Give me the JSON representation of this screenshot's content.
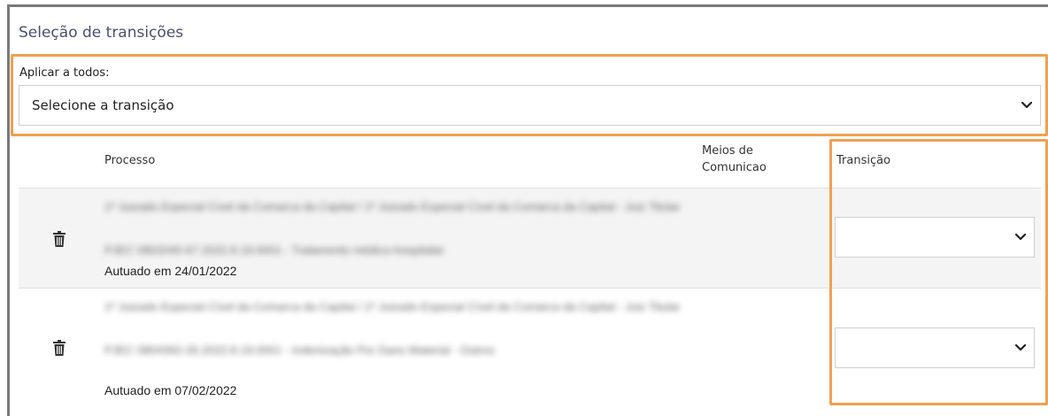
{
  "panel": {
    "title": "Seleção de transições"
  },
  "apply_all": {
    "label": "Aplicar a todos:",
    "select_value": "Selecione a transição"
  },
  "table": {
    "headers": {
      "processo": "Processo",
      "meios": "Meios de Comunicao",
      "transicao": "Transição"
    },
    "rows": [
      {
        "court": "1º Juizado Especial Cível da Comarca da Capital / 1º Juizado Especial Cível da Comarca da Capital - Juiz Titular",
        "process": "PJEC 0802045-67.2022.8.19.0001 - Tratamento médico-hospitalar",
        "autuado": "Autuado em 24/01/2022",
        "transition": ""
      },
      {
        "court": "1º Juizado Especial Cível da Comarca da Capital / 1º Juizado Especial Cível da Comarca da Capital - Juiz Titular",
        "process": "PJEC 0804392-26.2022.8.19.0001 - Indenização Por Dano Material - Outros",
        "autuado": "Autuado em 07/02/2022",
        "transition": ""
      }
    ]
  },
  "colors": {
    "highlight": "#f0a050",
    "row_alt": "#f4f4f4",
    "frame": "#7a7a7a"
  }
}
